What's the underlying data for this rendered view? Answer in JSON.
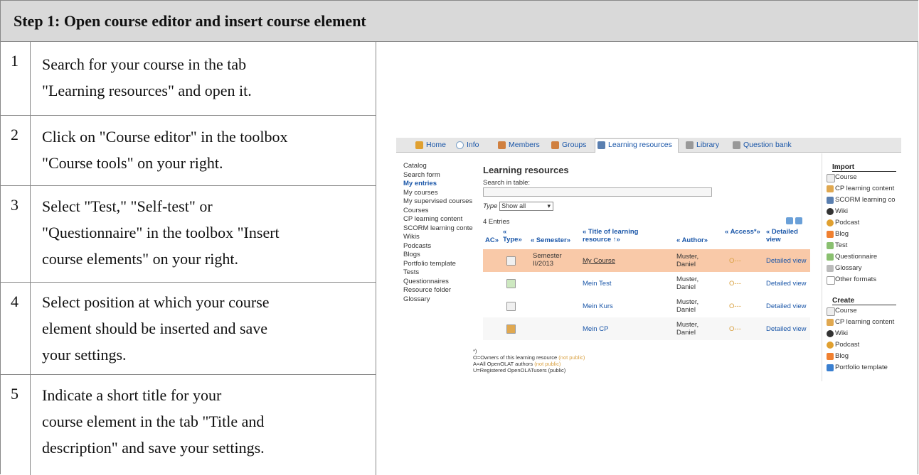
{
  "header": {
    "title": "Step 1: Open course editor and insert course element"
  },
  "steps": [
    {
      "num": "1",
      "lines": [
        "Search for your course in the tab",
        "\"Learning resources\" and open it."
      ]
    },
    {
      "num": "2",
      "lines": [
        "Click on \"Course editor\" in the toolbox",
        "\"Course tools\" on your right."
      ]
    },
    {
      "num": "3",
      "lines": [
        "Select \"Test,\" \"Self-test\" or",
        "\"Questionnaire\" in the toolbox \"Insert",
        "course elements\" on your right."
      ]
    },
    {
      "num": "4",
      "lines": [
        "Select position at which your course",
        "element should be inserted and save",
        "your settings."
      ]
    },
    {
      "num": "5",
      "lines": [
        "Indicate a short title for your",
        "course element in the tab \"Title and",
        "description\" and save your settings."
      ]
    }
  ],
  "screenshot": {
    "tabs": [
      {
        "label": "Home",
        "icon": "home-icon",
        "color": "#e0a030"
      },
      {
        "label": "Info",
        "icon": "info-icon",
        "color": "#7aa0c8"
      },
      {
        "label": "Members",
        "icon": "members-icon",
        "color": "#d08040"
      },
      {
        "label": "Groups",
        "icon": "groups-icon",
        "color": "#d08040"
      },
      {
        "label": "Learning resources",
        "icon": "learning-resources-icon",
        "color": "#5a7fb0"
      },
      {
        "label": "Library",
        "icon": "library-icon",
        "color": "#999999"
      },
      {
        "label": "Question bank",
        "icon": "question-bank-icon",
        "color": "#999999"
      }
    ],
    "left_nav": [
      "Catalog",
      "Search form",
      "My entries",
      "My courses",
      "My supervised courses",
      "Courses",
      "CP learning content",
      "SCORM learning content",
      "Wikis",
      "Podcasts",
      "Blogs",
      "Portfolio template",
      "Tests",
      "Questionnaires",
      "Resource folder",
      "Glossary"
    ],
    "title": "Learning resources",
    "search_label": "Search in table:",
    "type_label": "Type",
    "type_value": "Show all",
    "entries": "4 Entries",
    "columns": [
      "AC»",
      "« Type»",
      "« Semester»",
      "« Title of learning resource ↑»",
      "« Author»",
      "« Access*»",
      "« Detailed view"
    ],
    "rows": [
      {
        "semester": "Semester II/2013",
        "title": "My Course",
        "author": "Muster, Daniel",
        "access": "O---",
        "detail": "Detailed view"
      },
      {
        "semester": "",
        "title": "Mein Test",
        "author": "Muster, Daniel",
        "access": "O---",
        "detail": "Detailed view"
      },
      {
        "semester": "",
        "title": "Mein Kurs",
        "author": "Muster, Daniel",
        "access": "O---",
        "detail": "Detailed view"
      },
      {
        "semester": "",
        "title": "Mein CP",
        "author": "Muster, Daniel",
        "access": "O---",
        "detail": "Detailed view"
      }
    ],
    "import_title": "Import",
    "import_items": [
      "Course",
      "CP learning content",
      "SCORM learning co",
      "Wiki",
      "Podcast",
      "Blog",
      "Test",
      "Questionnaire",
      "Glossary",
      "Other formats"
    ],
    "create_title": "Create",
    "create_items": [
      "Course",
      "CP learning content",
      "Wiki",
      "Podcast",
      "Blog",
      "Portfolio template"
    ],
    "footnote": {
      "star": "*)",
      "l1": "O=Owners of this learning resource",
      "l1m": "(not public)",
      "l2": "A=All OpenOLAT authors",
      "l2m": "(not public)",
      "l3": "U=Registered OpenOLATusers (public)"
    }
  }
}
